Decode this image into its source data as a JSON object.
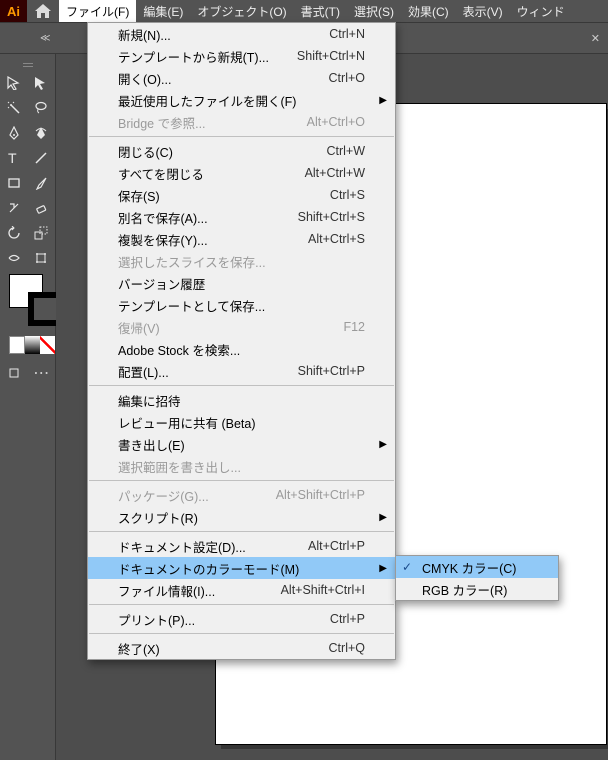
{
  "app": {
    "logo": "Ai"
  },
  "menubar": [
    "ファイル(F)",
    "編集(E)",
    "オブジェクト(O)",
    "書式(T)",
    "選択(S)",
    "効果(C)",
    "表示(V)",
    "ウィンド"
  ],
  "file_menu": {
    "groups": [
      [
        {
          "label": "新規(N)...",
          "shortcut": "Ctrl+N"
        },
        {
          "label": "テンプレートから新規(T)...",
          "shortcut": "Shift+Ctrl+N"
        },
        {
          "label": "開く(O)...",
          "shortcut": "Ctrl+O"
        },
        {
          "label": "最近使用したファイルを開く(F)",
          "sub": true
        },
        {
          "label": "Bridge で参照...",
          "shortcut": "Alt+Ctrl+O",
          "disabled": true
        }
      ],
      [
        {
          "label": "閉じる(C)",
          "shortcut": "Ctrl+W"
        },
        {
          "label": "すべてを閉じる",
          "shortcut": "Alt+Ctrl+W"
        },
        {
          "label": "保存(S)",
          "shortcut": "Ctrl+S"
        },
        {
          "label": "別名で保存(A)...",
          "shortcut": "Shift+Ctrl+S"
        },
        {
          "label": "複製を保存(Y)...",
          "shortcut": "Alt+Ctrl+S"
        },
        {
          "label": "選択したスライスを保存...",
          "disabled": true
        },
        {
          "label": "バージョン履歴"
        },
        {
          "label": "テンプレートとして保存..."
        },
        {
          "label": "復帰(V)",
          "shortcut": "F12",
          "disabled": true
        },
        {
          "label": "Adobe Stock を検索..."
        },
        {
          "label": "配置(L)...",
          "shortcut": "Shift+Ctrl+P"
        }
      ],
      [
        {
          "label": "編集に招待"
        },
        {
          "label": "レビュー用に共有 (Beta)"
        },
        {
          "label": "書き出し(E)",
          "sub": true
        },
        {
          "label": "選択範囲を書き出し...",
          "disabled": true
        }
      ],
      [
        {
          "label": "パッケージ(G)...",
          "shortcut": "Alt+Shift+Ctrl+P",
          "disabled": true
        },
        {
          "label": "スクリプト(R)",
          "sub": true
        }
      ],
      [
        {
          "label": "ドキュメント設定(D)...",
          "shortcut": "Alt+Ctrl+P"
        },
        {
          "label": "ドキュメントのカラーモード(M)",
          "sub": true,
          "highlight": true
        },
        {
          "label": "ファイル情報(I)...",
          "shortcut": "Alt+Shift+Ctrl+I"
        }
      ],
      [
        {
          "label": "プリント(P)...",
          "shortcut": "Ctrl+P"
        }
      ],
      [
        {
          "label": "終了(X)",
          "shortcut": "Ctrl+Q"
        }
      ]
    ]
  },
  "color_mode_submenu": [
    {
      "label": "CMYK カラー(C)",
      "checked": true,
      "highlight": true
    },
    {
      "label": "RGB カラー(R)"
    }
  ]
}
